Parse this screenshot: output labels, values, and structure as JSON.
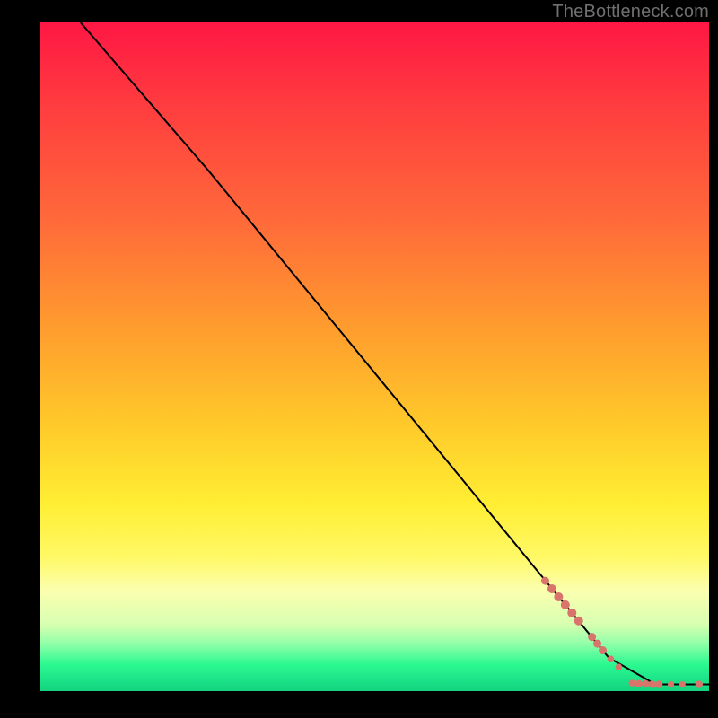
{
  "attribution": "TheBottleneck.com",
  "colors": {
    "black": "#000000",
    "marker": "#d9746c",
    "line": "#000000"
  },
  "gradient_stops": [
    {
      "offset": 0,
      "color": "#ff1744"
    },
    {
      "offset": 12,
      "color": "#ff3b3f"
    },
    {
      "offset": 30,
      "color": "#ff6b3a"
    },
    {
      "offset": 45,
      "color": "#ff9a2e"
    },
    {
      "offset": 60,
      "color": "#ffc92a"
    },
    {
      "offset": 72,
      "color": "#ffee33"
    },
    {
      "offset": 80,
      "color": "#fff966"
    },
    {
      "offset": 85,
      "color": "#fbffb0"
    },
    {
      "offset": 90,
      "color": "#d8ffb0"
    },
    {
      "offset": 93,
      "color": "#8effa8"
    },
    {
      "offset": 96,
      "color": "#2cf990"
    },
    {
      "offset": 98,
      "color": "#1fe68a"
    },
    {
      "offset": 100,
      "color": "#14d37e"
    }
  ],
  "chart_data": {
    "type": "line",
    "title": "",
    "xlabel": "",
    "ylabel": "",
    "xlim": [
      0,
      100
    ],
    "ylim": [
      0,
      100
    ],
    "series": [
      {
        "name": "curve",
        "style": "line-black",
        "points": [
          {
            "x": 6,
            "y": 100
          },
          {
            "x": 25,
            "y": 78
          },
          {
            "x": 85,
            "y": 5
          },
          {
            "x": 92,
            "y": 1
          },
          {
            "x": 100,
            "y": 1
          }
        ]
      },
      {
        "name": "markers-diagonal",
        "style": "marker",
        "points": [
          {
            "x": 75.5,
            "y": 16.5,
            "r": 4.5
          },
          {
            "x": 76.5,
            "y": 15.3,
            "r": 5.0
          },
          {
            "x": 77.5,
            "y": 14.1,
            "r": 5.0
          },
          {
            "x": 78.5,
            "y": 12.9,
            "r": 5.0
          },
          {
            "x": 79.5,
            "y": 11.7,
            "r": 5.0
          },
          {
            "x": 80.5,
            "y": 10.5,
            "r": 5.0
          },
          {
            "x": 82.5,
            "y": 8.1,
            "r": 4.5
          },
          {
            "x": 83.3,
            "y": 7.1,
            "r": 4.5
          },
          {
            "x": 84.1,
            "y": 6.1,
            "r": 4.5
          },
          {
            "x": 85.3,
            "y": 4.8,
            "r": 3.8
          },
          {
            "x": 86.5,
            "y": 3.6,
            "r": 3.8
          }
        ]
      },
      {
        "name": "markers-flat",
        "style": "marker",
        "points": [
          {
            "x": 88.5,
            "y": 1.2,
            "r": 3.8
          },
          {
            "x": 89.5,
            "y": 1.1,
            "r": 4.2
          },
          {
            "x": 90.5,
            "y": 1.1,
            "r": 4.2
          },
          {
            "x": 91.5,
            "y": 1.0,
            "r": 4.2
          },
          {
            "x": 92.5,
            "y": 1.0,
            "r": 4.2
          },
          {
            "x": 94.3,
            "y": 1.0,
            "r": 3.6
          },
          {
            "x": 96.0,
            "y": 1.0,
            "r": 3.6
          },
          {
            "x": 98.5,
            "y": 1.0,
            "r": 4.2
          }
        ]
      }
    ]
  }
}
